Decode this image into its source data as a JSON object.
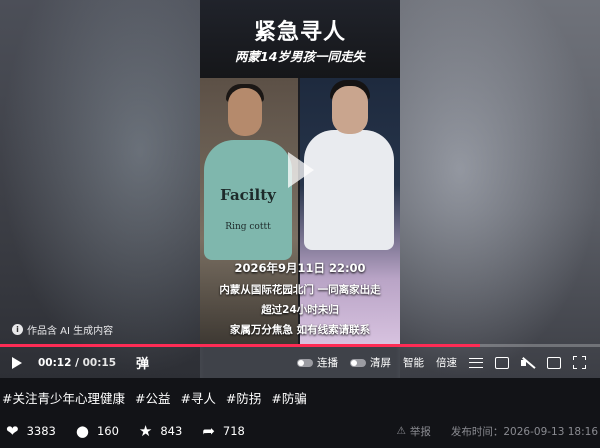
{
  "video": {
    "title": "紧急寻人",
    "subtitle": "两蒙14岁男孩一同走失",
    "shirt_text_main": "Facilty",
    "shirt_text_sub": "Ring cottt",
    "info_line1": "2026年9月11日 22:00",
    "info_line2": "内蒙从国际花园北门 一同离家出走",
    "info_line3": "超过24小时未归",
    "info_line4": "家属万分焦急 如有线索请联系",
    "ai_note": "作品含 AI 生成内容",
    "progress_fraction": 0.8
  },
  "controls": {
    "current_time": "00:12",
    "separator": " / ",
    "total_time": "00:15",
    "danmaku_label": "弹",
    "autoplay_label": "连播",
    "clearscreen_label": "清屏",
    "smart_label": "智能",
    "speed_label": "倍速"
  },
  "description": {
    "tags": [
      "#关注青少年心理健康",
      "#公益",
      "#寻人",
      "#防拐",
      "#防骗"
    ]
  },
  "actions": {
    "likes": "3383",
    "comments": "160",
    "favorites": "843",
    "shares": "718",
    "report_label": "举报",
    "publish_label": "发布时间：",
    "publish_time": "2026-09-13 18:16"
  }
}
